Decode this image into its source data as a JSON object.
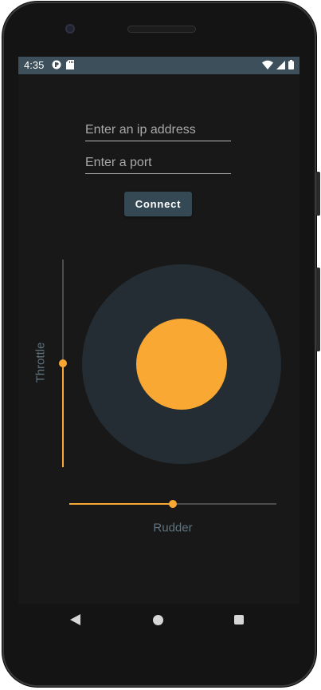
{
  "status_bar": {
    "time": "4:35",
    "left_icons": [
      "app-notification-icon",
      "sd-card-icon"
    ],
    "right_icons": [
      "wifi-icon",
      "cell-signal-icon",
      "battery-icon"
    ]
  },
  "connection": {
    "ip_placeholder": "Enter an ip address",
    "ip_value": "",
    "port_placeholder": "Enter a port",
    "port_value": "",
    "connect_label": "Connect"
  },
  "controls": {
    "throttle_label": "Throttle",
    "throttle_level": 0.5,
    "rudder_label": "Rudder",
    "rudder_level": 0.5,
    "joystick_position": "center"
  },
  "nav_bar": {
    "icons": [
      "back-icon",
      "home-icon",
      "recents-icon"
    ]
  },
  "colors": {
    "accent": "#f9a933",
    "primary": "#354955",
    "status_bar": "#3c4f5a",
    "joystick_base": "#232d33",
    "background": "#181818",
    "label": "#60737e"
  }
}
